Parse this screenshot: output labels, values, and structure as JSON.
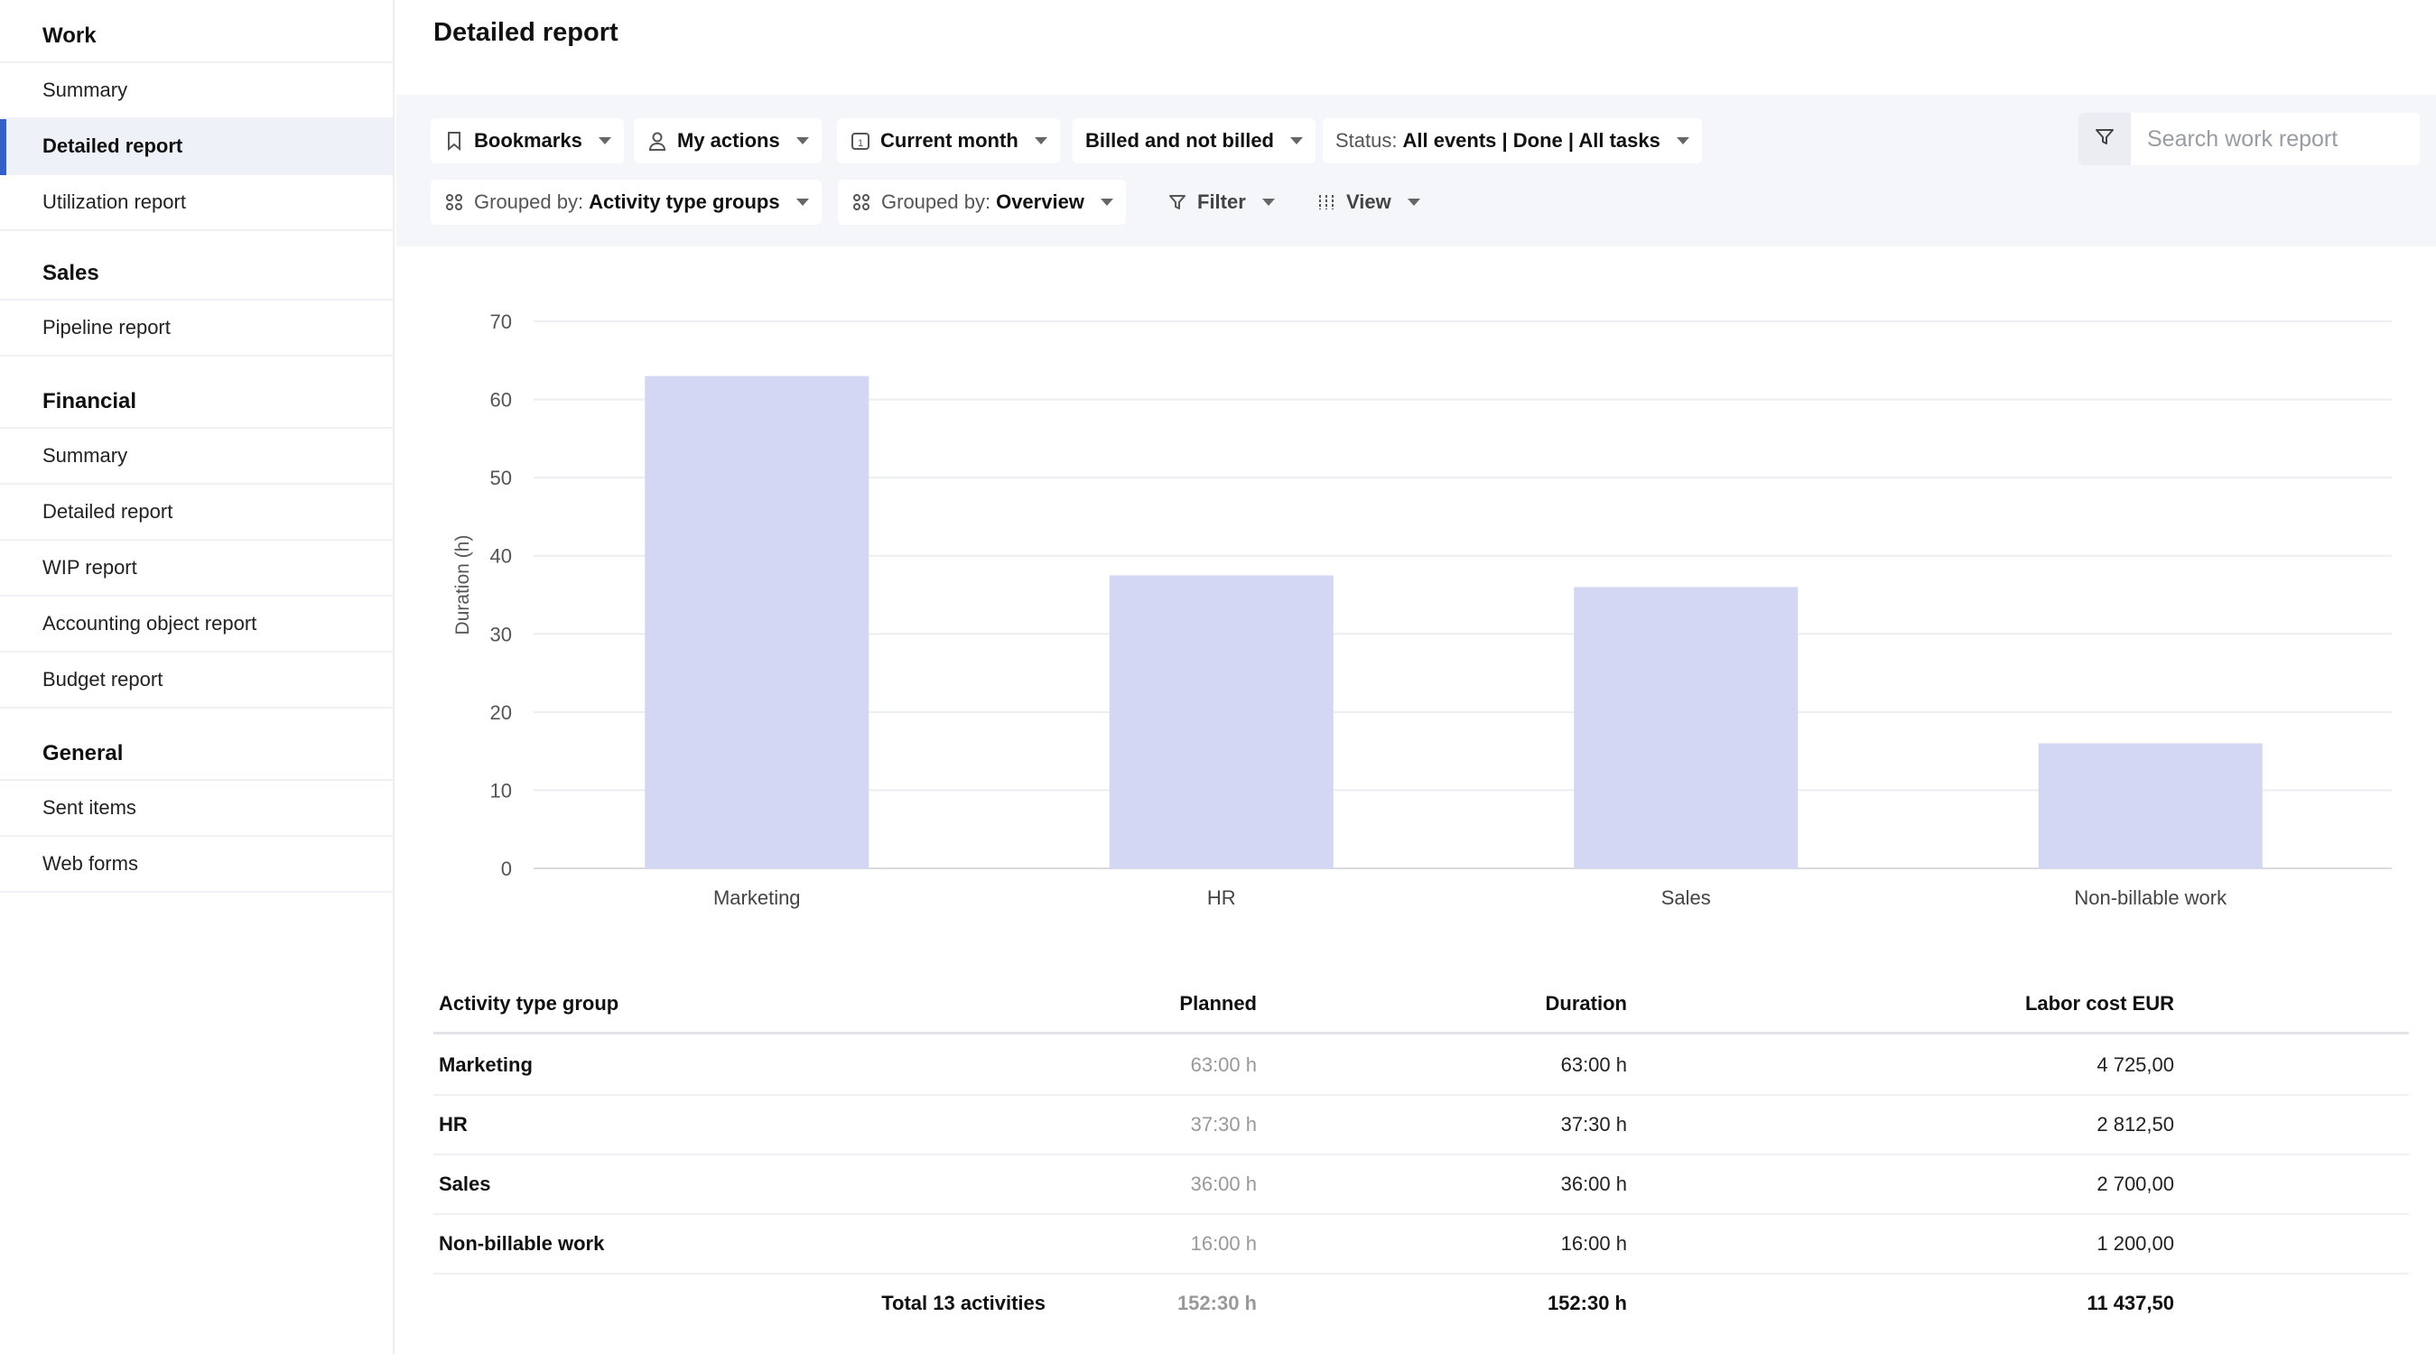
{
  "sidebar": {
    "sections": [
      {
        "title": "Work",
        "items": [
          {
            "label": "Summary"
          },
          {
            "label": "Detailed report",
            "active": true
          },
          {
            "label": "Utilization report"
          }
        ]
      },
      {
        "title": "Sales",
        "items": [
          {
            "label": "Pipeline report"
          }
        ]
      },
      {
        "title": "Financial",
        "items": [
          {
            "label": "Summary"
          },
          {
            "label": "Detailed report"
          },
          {
            "label": "WIP report"
          },
          {
            "label": "Accounting object report"
          },
          {
            "label": "Budget report"
          }
        ]
      },
      {
        "title": "General",
        "items": [
          {
            "label": "Sent items"
          },
          {
            "label": "Web forms"
          }
        ]
      }
    ]
  },
  "page": {
    "title": "Detailed report"
  },
  "toolbar": {
    "bookmarks": "Bookmarks",
    "my_actions": "My actions",
    "period": "Current month",
    "billing": "Billed and not billed",
    "status_prefix": "Status:",
    "status_value": "All events | Done | All tasks",
    "group1_prefix": "Grouped by:",
    "group1_value": "Activity type groups",
    "group2_prefix": "Grouped by:",
    "group2_value": "Overview",
    "filter": "Filter",
    "view": "View",
    "search_placeholder": "Search work report"
  },
  "chart_data": {
    "type": "bar",
    "categories": [
      "Marketing",
      "HR",
      "Sales",
      "Non-billable work"
    ],
    "values": [
      63,
      37.5,
      36,
      16
    ],
    "ylabel": "Duration (h)",
    "ylim": [
      0,
      70
    ],
    "yticks": [
      0,
      10,
      20,
      30,
      40,
      50,
      60,
      70
    ],
    "grid": true,
    "bar_color": "#d4d7f3"
  },
  "table": {
    "headers": {
      "name": "Activity type group",
      "planned": "Planned",
      "duration": "Duration",
      "cost": "Labor cost EUR"
    },
    "rows": [
      {
        "name": "Marketing",
        "planned": "63:00 h",
        "duration": "63:00 h",
        "cost": "4 725,00"
      },
      {
        "name": "HR",
        "planned": "37:30 h",
        "duration": "37:30 h",
        "cost": "2 812,50"
      },
      {
        "name": "Sales",
        "planned": "36:00 h",
        "duration": "36:00 h",
        "cost": "2 700,00"
      },
      {
        "name": "Non-billable work",
        "planned": "16:00 h",
        "duration": "16:00 h",
        "cost": "1 200,00"
      }
    ],
    "total": {
      "label": "Total 13 activities",
      "planned": "152:30 h",
      "duration": "152:30 h",
      "cost": "11 437,50"
    }
  }
}
